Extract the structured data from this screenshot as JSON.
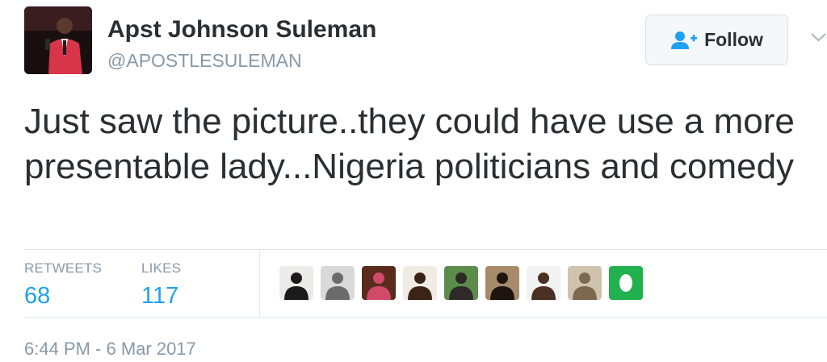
{
  "user": {
    "name": "Apst Johnson Suleman",
    "handle": "@APOSTLESULEMAN"
  },
  "follow_button": {
    "label": "Follow",
    "icon": "follow-user-icon"
  },
  "tweet": {
    "text": "Just saw the picture..they could have use a more presentable lady...Nigeria politicians and comedy"
  },
  "stats": {
    "retweets_label": "RETWEETS",
    "retweets_value": "68",
    "likes_label": "LIKES",
    "likes_value": "117"
  },
  "likers": [
    {
      "bg": "#ecebe8",
      "fg": "#1b1b1b"
    },
    {
      "bg": "#d9d9d9",
      "fg": "#6b6b6b"
    },
    {
      "bg": "#5a2b1d",
      "fg": "#d14a6a"
    },
    {
      "bg": "#f1ece3",
      "fg": "#3a2418"
    },
    {
      "bg": "#5b8c4a",
      "fg": "#2f2a27"
    },
    {
      "bg": "#a78a6a",
      "fg": "#1f1410"
    },
    {
      "bg": "#f2f2f2",
      "fg": "#4a2f23"
    },
    {
      "bg": "#cfc3ae",
      "fg": "#7d6950"
    },
    {
      "bg": "#21b14e",
      "fg": "#ffffff"
    }
  ],
  "timestamp": "6:44 PM - 6 Mar 2017",
  "colors": {
    "link_blue": "#1da1f2",
    "muted_gray": "#8899a6",
    "text_dark": "#292f33",
    "avatar_suit_red": "#d9354a"
  }
}
